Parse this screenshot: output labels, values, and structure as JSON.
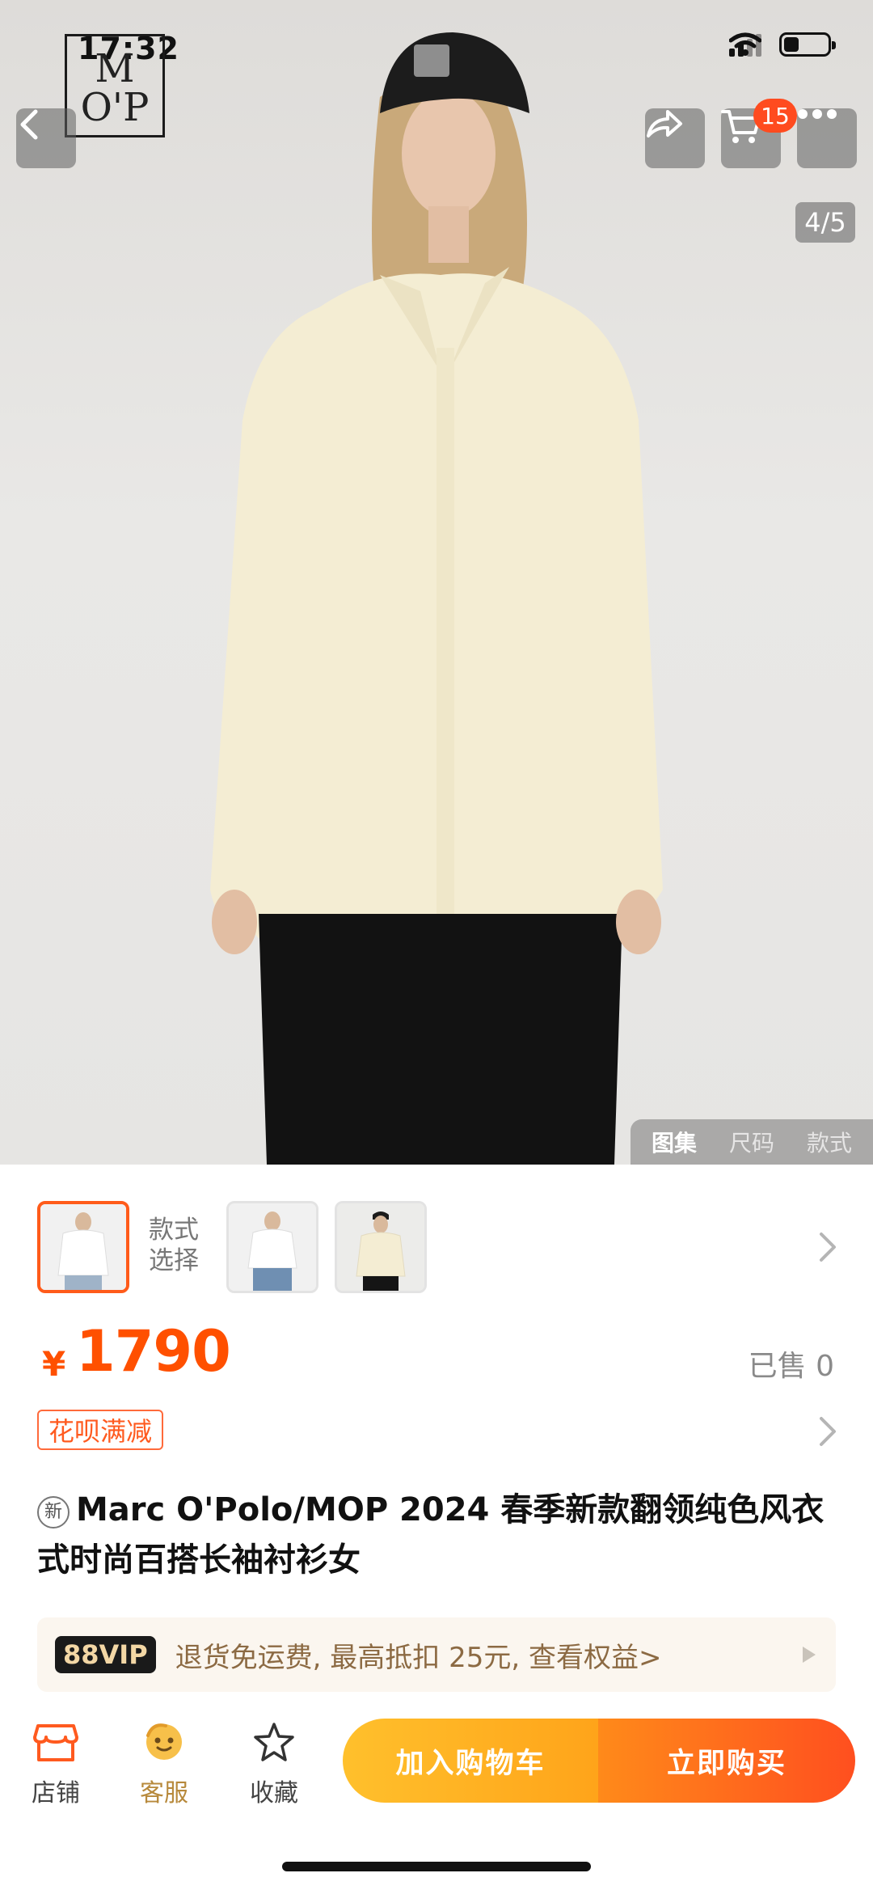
{
  "status_bar": {
    "time": "17:32"
  },
  "brand_logo": {
    "line1": "M",
    "line2": "O'P"
  },
  "header": {
    "cart_count": "15"
  },
  "gallery": {
    "page_indicator": "4/5",
    "tabs": [
      "图集",
      "尺码",
      "款式"
    ],
    "active_tab": "图集"
  },
  "variants": {
    "label": "款式选择"
  },
  "price": {
    "currency": "¥",
    "value": "1790",
    "sold": "已售 0"
  },
  "promo": {
    "tag": "花呗满减"
  },
  "product": {
    "new_badge": "新",
    "title": "Marc O'Polo/MOP 2024 春季新款翻领纯色风衣式时尚百搭长袖衬衫女"
  },
  "vip": {
    "badge": "88VIP",
    "text": "退货免运费, 最高抵扣 25元, 查看权益>"
  },
  "bottom_bar": {
    "shop": "店铺",
    "service": "客服",
    "favorite": "收藏",
    "add_to_cart": "加入购物车",
    "buy_now": "立即购买"
  },
  "colors": {
    "accent": "#ff5000",
    "cart_gradient": [
      "#ffc02c",
      "#ffa41a"
    ],
    "buy_gradient": [
      "#ff8a1a",
      "#ff4f1f"
    ]
  }
}
